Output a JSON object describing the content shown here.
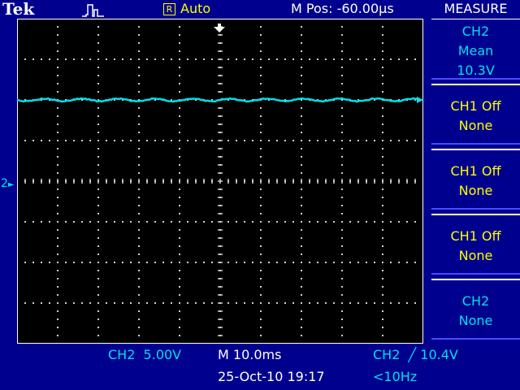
{
  "header": {
    "brand": "Tek",
    "acquisition_state": "Auto",
    "trigger_status_letter": "R",
    "position": "M Pos: -60.00µs",
    "menu_title": "MEASURE"
  },
  "measurements": [
    {
      "line1": "CH2",
      "line2": "Mean",
      "line3": "10.3V",
      "color": "cyan"
    },
    {
      "line1": "CH1 Off",
      "line2": "None",
      "line3": "",
      "color": "yellow"
    },
    {
      "line1": "CH1 Off",
      "line2": "None",
      "line3": "",
      "color": "yellow"
    },
    {
      "line1": "CH1 Off",
      "line2": "None",
      "line3": "",
      "color": "yellow"
    },
    {
      "line1": "CH2",
      "line2": "None",
      "line3": "",
      "color": "cyan"
    }
  ],
  "footer": {
    "ch2_scale": "CH2  5.00V",
    "timebase": "M 10.0ms",
    "trigger": "CH2  ╱ 10.4V",
    "datetime": "25-Oct-10 19:17",
    "frequency": "<10Hz"
  },
  "markers": {
    "ch2_ground": "2"
  },
  "colors": {
    "background": "#00008f",
    "screen": "#000000",
    "grid": "#d0d0d0",
    "trace_ch2": "#00e0e8",
    "ch1": "#ffff00",
    "border": "#ffffff"
  },
  "waveform": {
    "channel": "CH2",
    "level_divisions_above_center": 2,
    "ripple_cycles": 11
  }
}
